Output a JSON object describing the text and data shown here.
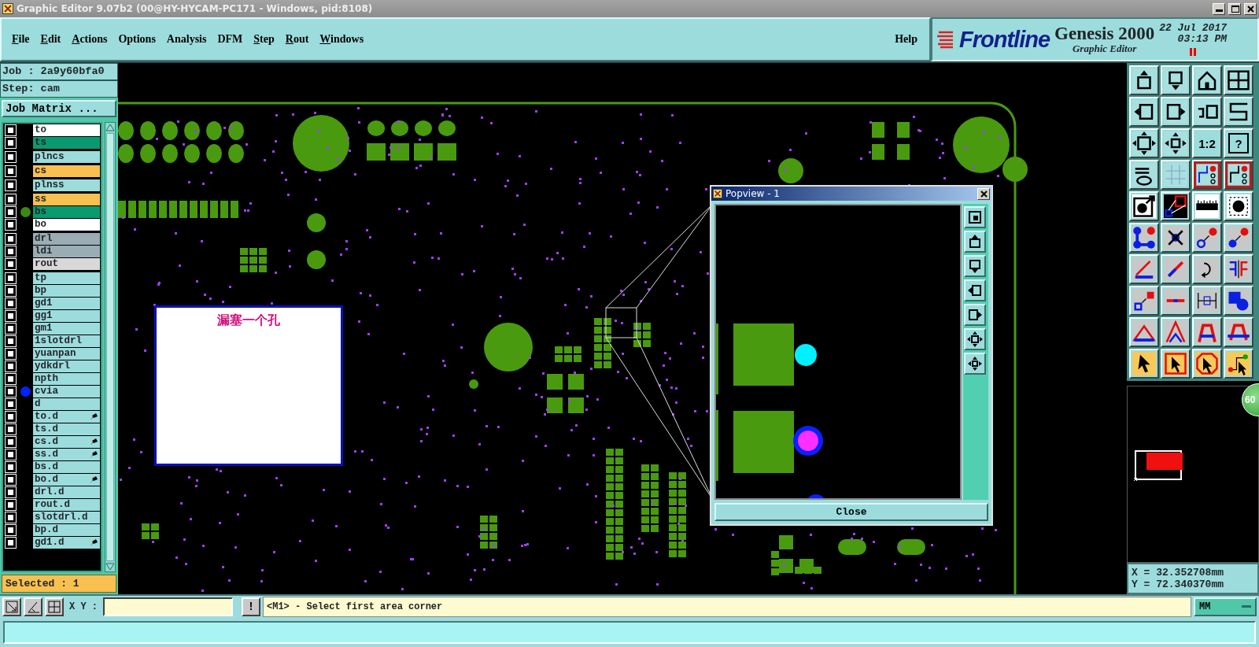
{
  "window": {
    "title": "Graphic Editor 9.07b2 (00@HY-HYCAM-PC171 - Windows, pid:8108)"
  },
  "menu": [
    {
      "label": "File",
      "mnemonic": true
    },
    {
      "label": "Edit",
      "mnemonic": true
    },
    {
      "label": "Actions",
      "mnemonic": true
    },
    {
      "label": "Options",
      "mnemonic": false
    },
    {
      "label": "Analysis",
      "mnemonic": false
    },
    {
      "label": "DFM",
      "mnemonic": false
    },
    {
      "label": "Step",
      "mnemonic": true
    },
    {
      "label": "Rout",
      "mnemonic": true
    },
    {
      "label": "Windows",
      "mnemonic": true
    }
  ],
  "help": "Help",
  "brand": {
    "logo": "Frontline",
    "product": "Genesis 2000",
    "subtitle": "Graphic Editor",
    "date": "22 Jul 2017",
    "time": "03:13 PM"
  },
  "job": "Job : 2a9y60bfa0",
  "step": "Step: cam",
  "job_matrix_button": "Job Matrix ...",
  "layer_groups": [
    {
      "layers": [
        {
          "name": "to",
          "color": "#ffffff",
          "checked": false,
          "marked": false
        },
        {
          "name": "ts",
          "color": "#0a9a70",
          "checked": false,
          "marked": false
        }
      ]
    },
    {
      "layers": [
        {
          "name": "plncs",
          "color": "#9cdcdc",
          "checked": false,
          "marked": false
        }
      ]
    },
    {
      "layers": [
        {
          "name": "cs",
          "color": "#f8c050",
          "checked": false,
          "marked": false
        }
      ]
    },
    {
      "layers": [
        {
          "name": "plnss",
          "color": "#9cdcdc",
          "checked": false,
          "marked": false
        }
      ]
    },
    {
      "layers": [
        {
          "name": "ss",
          "color": "#f8c050",
          "checked": false,
          "marked": false
        },
        {
          "name": "bs",
          "color": "#0a9a70",
          "checked": false,
          "marked": false,
          "dot": {
            "color": "#3a8a10"
          }
        },
        {
          "name": "bo",
          "color": "#ffffff",
          "checked": false,
          "marked": false
        }
      ]
    },
    {
      "layers": [
        {
          "name": "drl",
          "color": "#9aacb4",
          "checked": false,
          "marked": false
        },
        {
          "name": "ldi",
          "color": "#9aacb4",
          "checked": false,
          "marked": false
        },
        {
          "name": "rout",
          "color": "#d8d8d8",
          "checked": false,
          "marked": false
        }
      ]
    },
    {
      "layers": [
        {
          "name": "tp",
          "color": "#9cdcdc",
          "checked": false,
          "marked": false
        },
        {
          "name": "bp",
          "color": "#9cdcdc",
          "checked": false,
          "marked": false
        },
        {
          "name": "gd1",
          "color": "#9cdcdc",
          "checked": false,
          "marked": false
        },
        {
          "name": "gg1",
          "color": "#9cdcdc",
          "checked": false,
          "marked": false
        },
        {
          "name": "gm1",
          "color": "#9cdcdc",
          "checked": false,
          "marked": false
        },
        {
          "name": "1slotdrl",
          "color": "#9cdcdc",
          "checked": false,
          "marked": false
        },
        {
          "name": "yuanpan",
          "color": "#9cdcdc",
          "checked": false,
          "marked": false
        },
        {
          "name": "ydkdrl",
          "color": "#9cdcdc",
          "checked": false,
          "marked": false
        },
        {
          "name": "npth",
          "color": "#9cdcdc",
          "checked": false,
          "marked": false
        },
        {
          "name": "cvia",
          "color": "#9cdcdc",
          "checked": false,
          "marked": false,
          "dot": {
            "color": "#0022ff"
          }
        },
        {
          "name": "d",
          "color": "#9cdcdc",
          "checked": false,
          "marked": false
        },
        {
          "name": "to.d",
          "color": "#9cdcdc",
          "checked": false,
          "marked": true
        },
        {
          "name": "ts.d",
          "color": "#9cdcdc",
          "checked": false,
          "marked": false
        },
        {
          "name": "cs.d",
          "color": "#9cdcdc",
          "checked": false,
          "marked": true
        },
        {
          "name": "ss.d",
          "color": "#9cdcdc",
          "checked": false,
          "marked": true
        },
        {
          "name": "bs.d",
          "color": "#9cdcdc",
          "checked": false,
          "marked": false
        },
        {
          "name": "bo.d",
          "color": "#9cdcdc",
          "checked": false,
          "marked": true
        },
        {
          "name": "drl.d",
          "color": "#9cdcdc",
          "checked": false,
          "marked": false
        },
        {
          "name": "rout.d",
          "color": "#9cdcdc",
          "checked": false,
          "marked": false
        },
        {
          "name": "slotdrl.d",
          "color": "#9cdcdc",
          "checked": false,
          "marked": false
        },
        {
          "name": "bp.d",
          "color": "#9cdcdc",
          "checked": false,
          "marked": false
        },
        {
          "name": "gd1.d",
          "color": "#9cdcdc",
          "checked": false,
          "marked": true
        }
      ]
    }
  ],
  "selected_count": "Selected : 1",
  "note": {
    "text": "漏塞一个孔"
  },
  "popview": {
    "title": "Popview - 1",
    "close_button": "Close"
  },
  "toolbar_labels": {
    "scale": "1:2",
    "help": "?"
  },
  "badge": "60",
  "readout": {
    "x": "X = 32.352708mm",
    "y": "Y = 72.340370mm"
  },
  "command_bar": {
    "xy_label": "X Y :",
    "exclaim": "!",
    "message": "<M1> - Select first area corner",
    "units": "MM"
  }
}
